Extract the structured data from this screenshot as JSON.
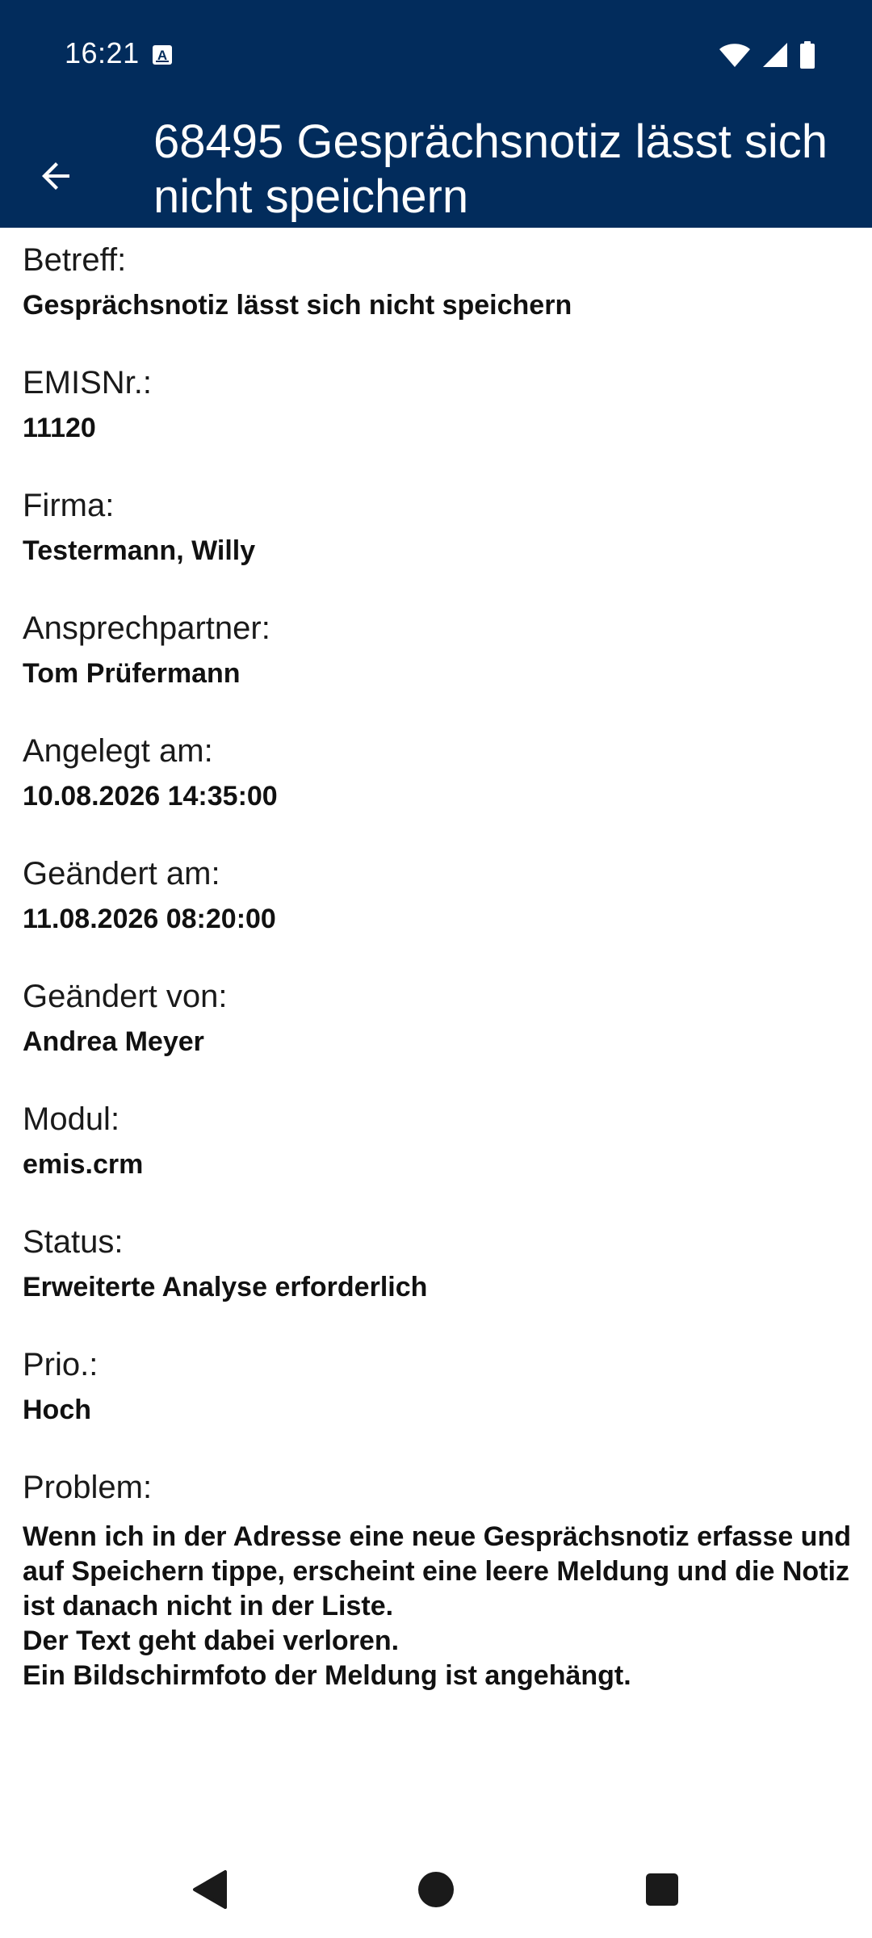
{
  "status_bar": {
    "time": "16:21"
  },
  "header": {
    "title": "68495 Gesprächsnotiz lässt sich nicht speichern"
  },
  "fields": [
    {
      "label": "Betreff:",
      "value": "Gesprächsnotiz lässt sich nicht speichern"
    },
    {
      "label": "EMISNr.:",
      "value": "11120"
    },
    {
      "label": "Firma:",
      "value": "Testermann, Willy"
    },
    {
      "label": "Ansprechpartner:",
      "value": "Tom Prüfermann"
    },
    {
      "label": "Angelegt am:",
      "value": "10.08.2026 14:35:00"
    },
    {
      "label": "Geändert am:",
      "value": "11.08.2026 08:20:00"
    },
    {
      "label": "Geändert von:",
      "value": "Andrea Meyer"
    },
    {
      "label": "Modul:",
      "value": "emis.crm"
    },
    {
      "label": "Status:",
      "value": "Erweiterte Analyse erforderlich"
    },
    {
      "label": "Prio.:",
      "value": "Hoch"
    }
  ],
  "problem": {
    "label": "Problem:",
    "lines": [
      "Wenn ich in der Adresse eine neue Gesprächsnotiz erfasse und",
      "auf Speichern tippe, erscheint eine leere Meldung und die Notiz",
      "ist danach nicht in der Liste.",
      "Der Text geht dabei verloren.",
      "Ein Bildschirmfoto der Meldung ist angehängt."
    ]
  },
  "icons": {
    "back": "arrow-back-icon",
    "notification": "text-notification-icon",
    "wifi": "wifi-icon",
    "signal": "cell-signal-icon",
    "battery": "battery-icon",
    "nav_back": "nav-back-icon",
    "nav_home": "nav-home-icon",
    "nav_recents": "nav-recents-icon"
  },
  "colors": {
    "app_bar": "#022c5c",
    "text": "#1a1a1a"
  }
}
